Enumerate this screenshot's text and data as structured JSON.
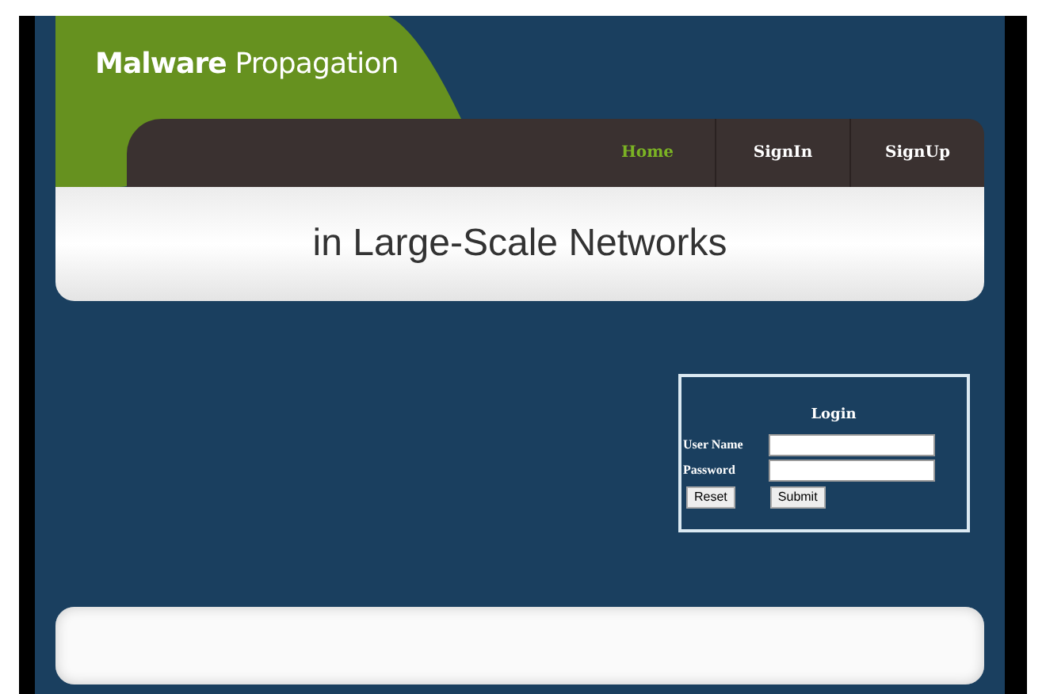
{
  "site_title": "**Malware** Propagation",
  "nav": [
    {
      "label": "Home",
      "selected": true
    },
    {
      "label": "SignIn",
      "selected": false
    },
    {
      "label": "SignUp",
      "selected": false
    }
  ],
  "banner": {
    "subtitle": "in Large-Scale Networks"
  },
  "login": {
    "heading": "Login",
    "fields": [
      {
        "label": "User Name"
      },
      {
        "label": "Password"
      }
    ],
    "buttons": [
      "Reset",
      "Submit"
    ]
  }
}
